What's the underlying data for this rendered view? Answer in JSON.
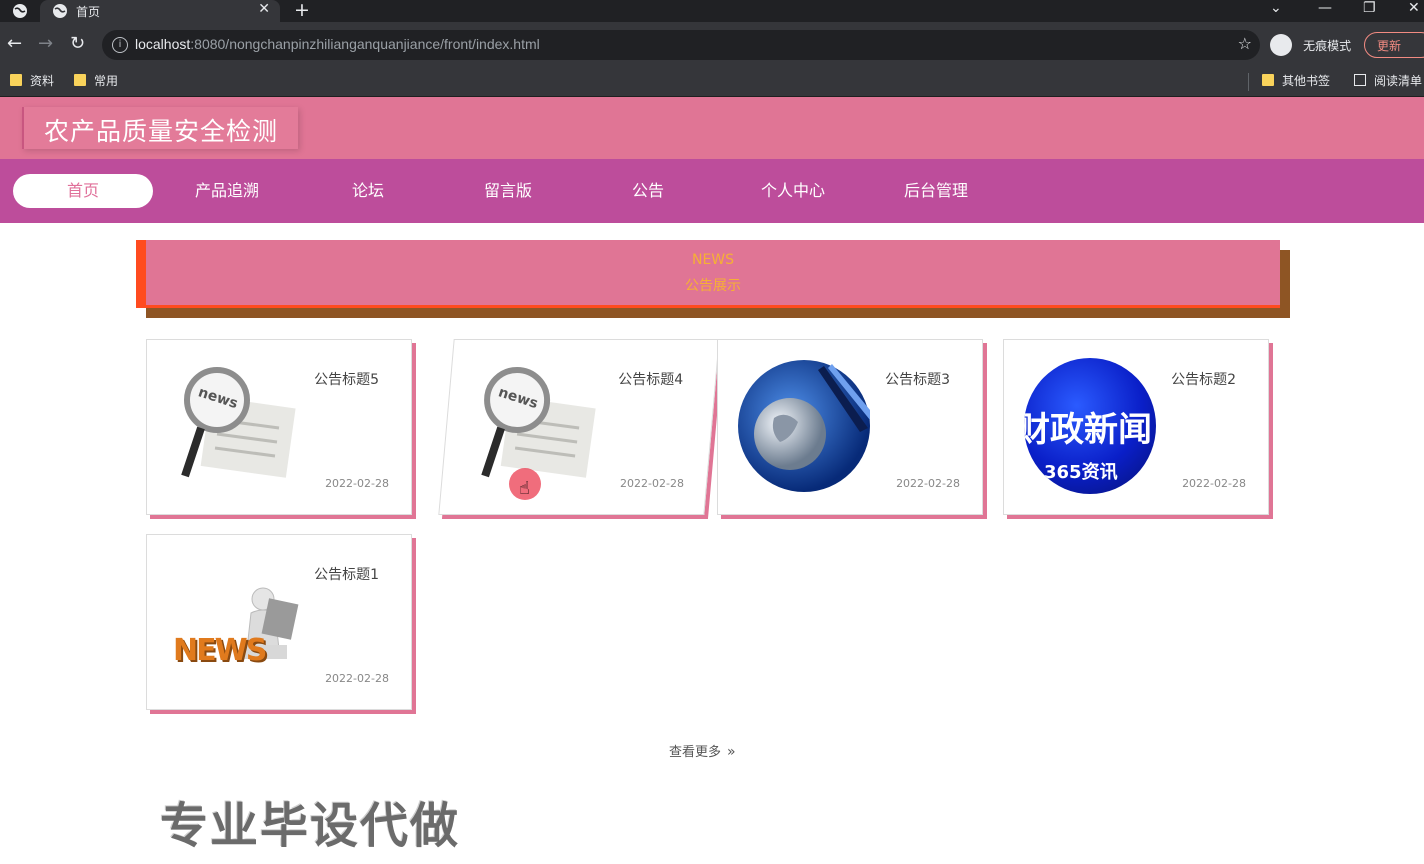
{
  "browser": {
    "tab_title": "首页",
    "new_tab": "+",
    "url_host": "localhost",
    "url_rest": ":8080/nongchanpinzhilianganquanjiance/front/index.html",
    "incognito_label": "无痕模式",
    "update_label": "更新",
    "bookmarks": [
      "资料",
      "常用"
    ],
    "bookmarks_right": [
      "其他书签",
      "阅读清单"
    ]
  },
  "site": {
    "title": "农产品质量安全检测"
  },
  "nav": {
    "items": [
      "首页",
      "产品追溯",
      "论坛",
      "留言版",
      "公告",
      "个人中心",
      "后台管理"
    ],
    "active": "首页"
  },
  "banner": {
    "en": "NEWS",
    "cn": "公告展示"
  },
  "cards": [
    {
      "title": "公告标题5",
      "date": "2022-02-28",
      "thumb": "news-magnifier"
    },
    {
      "title": "公告标题4",
      "date": "2022-02-28",
      "thumb": "news-magnifier"
    },
    {
      "title": "公告标题3",
      "date": "2022-02-28",
      "thumb": "globe-news"
    },
    {
      "title": "公告标题2",
      "date": "2022-02-28",
      "thumb": "finance-news",
      "thumb_text": "财政新闻",
      "thumb_sub": "365资讯"
    },
    {
      "title": "公告标题1",
      "date": "2022-02-28",
      "thumb": "news-3d-reader",
      "thumb_text": "NEWS"
    }
  ],
  "more": {
    "label": "查看更多",
    "icon": "double-chevron-right-icon"
  },
  "watermark": "专业毕设代做",
  "colors": {
    "header": "#e07595",
    "navbar": "#bd4d9b",
    "banner_accent": "#ff4b1f",
    "banner_text": "#f6b034",
    "card_shadow": "#e07595"
  }
}
